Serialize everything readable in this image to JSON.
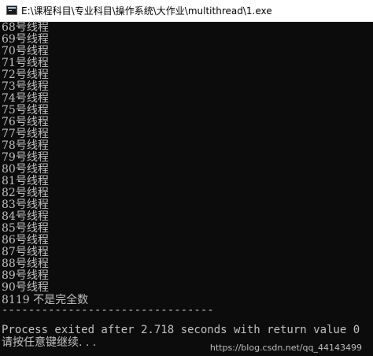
{
  "window": {
    "title": "E:\\课程科目\\专业科目\\操作系统\\大作业\\multithread\\1.exe",
    "title_icon": "console-app-icon"
  },
  "console": {
    "lines": [
      "68号线程",
      "69号线程",
      "70号线程",
      "71号线程",
      "72号线程",
      "73号线程",
      "74号线程",
      "75号线程",
      "76号线程",
      "77号线程",
      "78号线程",
      "79号线程",
      "80号线程",
      "81号线程",
      "82号线程",
      "83号线程",
      "84号线程",
      "85号线程",
      "86号线程",
      "87号线程",
      "88号线程",
      "89号线程",
      "90号线程",
      "8119 不是完全数",
      "--------------------------------",
      "Process exited after 2.718 seconds with return value 0",
      "请按任意键继续. . ."
    ]
  },
  "watermark": "https://blog.csdn.net/qq_44143499",
  "colors": {
    "background": "#0c0c0c",
    "text": "#c0c0c0",
    "titlebar": "#ffffff"
  }
}
